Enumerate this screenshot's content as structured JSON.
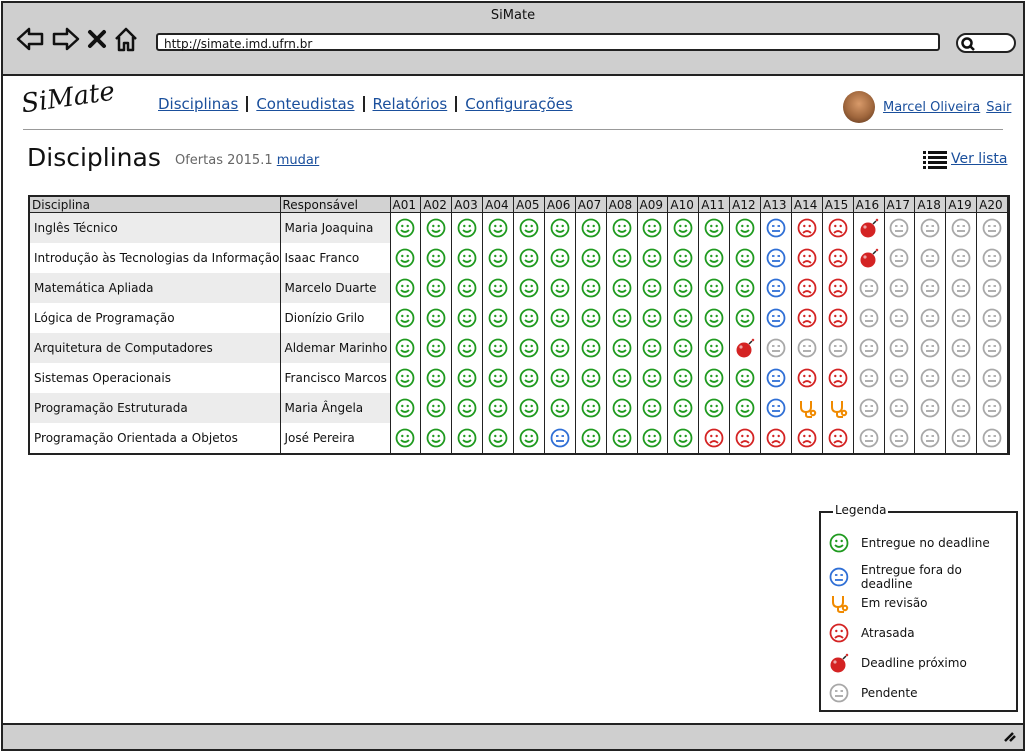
{
  "window": {
    "title": "SiMate"
  },
  "browser": {
    "url": "http://simate.imd.ufrn.br"
  },
  "app": {
    "logo": "SiMate"
  },
  "nav": [
    "Disciplinas",
    "Conteudistas",
    "Relatórios",
    "Configurações"
  ],
  "user": {
    "name": "Marcel Oliveira",
    "logout": "Sair"
  },
  "page": {
    "title": "Disciplinas",
    "offers": "Ofertas 2015.1",
    "change": "mudar",
    "list_view": "Ver lista"
  },
  "table": {
    "headers": {
      "discipline": "Disciplina",
      "responsible": "Responsável",
      "activities": [
        "A01",
        "A02",
        "A03",
        "A04",
        "A05",
        "A06",
        "A07",
        "A08",
        "A09",
        "A10",
        "A11",
        "A12",
        "A13",
        "A14",
        "A15",
        "A16",
        "A17",
        "A18",
        "A19",
        "A20"
      ]
    },
    "status_codes": {
      "G": "entregue",
      "B": "fora-do-deadline",
      "R": "atrasada",
      "O": "em-revisao",
      "D": "deadline-proximo",
      "P": "pendente"
    },
    "rows": [
      {
        "discipline": "Inglês Técnico",
        "responsible": "Maria Joaquina",
        "status": "GGGGGGGGGGGGBRRDPPPP"
      },
      {
        "discipline": "Introdução às Tecnologias da Informação",
        "responsible": "Isaac Franco",
        "status": "GGGGGGGGGGGGBRRDPPPP"
      },
      {
        "discipline": "Matemática Apliada",
        "responsible": "Marcelo Duarte",
        "status": "GGGGGGGGGGGGBRRPPPPP"
      },
      {
        "discipline": "Lógica de Programação",
        "responsible": "Dionízio Grilo",
        "status": "GGGGGGGGGGGGBRRPPPPP"
      },
      {
        "discipline": "Arquitetura de Computadores",
        "responsible": "Aldemar Marinho",
        "status": "GGGGGGGGGGGDPPPPPPPP"
      },
      {
        "discipline": "Sistemas Operacionais",
        "responsible": "Francisco Marcos",
        "status": "GGGGGGGGGGGGBRRPPPPP"
      },
      {
        "discipline": "Programação Estruturada",
        "responsible": "Maria Ângela",
        "status": "GGGGGGGGGGGGBOOPPPPP"
      },
      {
        "discipline": "Programação Orientada a Objetos",
        "responsible": "José Pereira",
        "status": "GGGGGBGGGGRRRRRPPPPP"
      }
    ]
  },
  "legend": {
    "title": "Legenda",
    "items": [
      {
        "code": "G",
        "label": "Entregue no deadline"
      },
      {
        "code": "B",
        "label": "Entregue fora do deadline"
      },
      {
        "code": "O",
        "label": "Em revisão"
      },
      {
        "code": "R",
        "label": "Atrasada"
      },
      {
        "code": "D",
        "label": "Deadline próximo"
      },
      {
        "code": "P",
        "label": "Pendente"
      }
    ]
  },
  "colors": {
    "green": "#1f9a1f",
    "blue": "#2f6fd6",
    "red": "#d42323",
    "orange": "#f08a00",
    "gray": "#a8a8a8",
    "link": "#1a4f9c"
  }
}
